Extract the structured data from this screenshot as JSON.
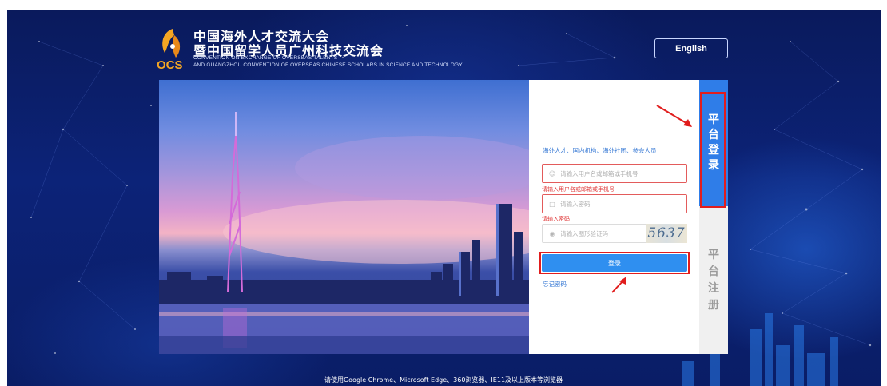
{
  "header": {
    "title_line1": "中国海外人才交流大会",
    "title_line2": "暨中国留学人员广州科技交流会",
    "abbreviation": "OCS",
    "subtitle_line1": "CONVENTION ON EXCHANGE OF OVERSEAS TALENTS",
    "subtitle_line2": "AND GUANGZHOU CONVENTION OF OVERSEAS CHINESE SCHOLARS IN SCIENCE AND TECHNOLOGY",
    "language_button": "English"
  },
  "login": {
    "hint": "海外人才、国内机构、海外社团、参会人员",
    "username_placeholder": "请输入用户名或邮箱或手机号",
    "username_error": "请输入用户名或邮箱或手机号",
    "password_placeholder": "请输入密码",
    "password_error": "请输入密码",
    "captcha_placeholder": "请输入图形验证码",
    "captcha_code": "5637",
    "submit_label": "登录",
    "forgot_label": "忘记密码"
  },
  "tabs": {
    "login": [
      "平",
      "台",
      "登",
      "录"
    ],
    "register": [
      "平",
      "台",
      "注",
      "册"
    ]
  },
  "footer": {
    "browser_note": "请使用Google Chrome、Microsoft Edge、360浏览器、IE11及以上版本等浏览器"
  },
  "colors": {
    "accent": "#2f7de8",
    "button": "#2f8ff0",
    "error": "#e03b3b",
    "annotation": "#e11d1d",
    "logo_orange": "#f5a623"
  }
}
